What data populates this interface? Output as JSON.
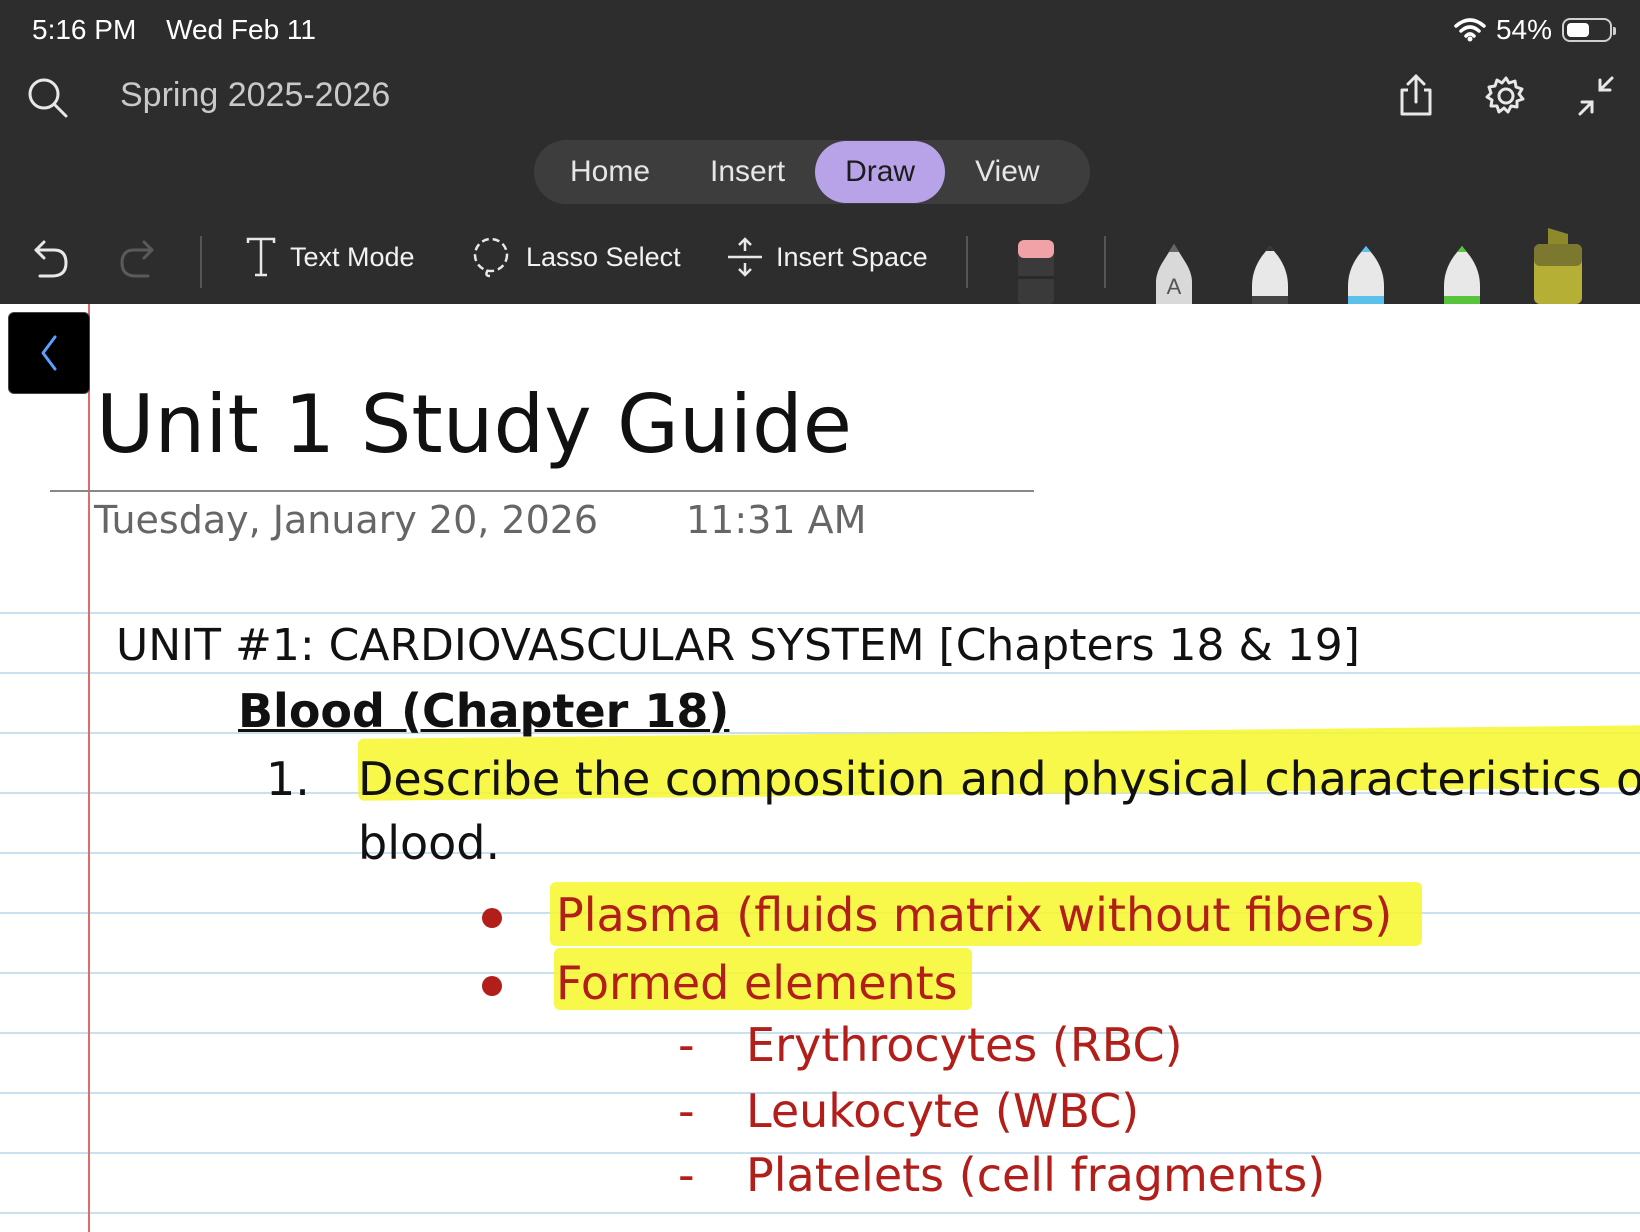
{
  "status_bar": {
    "time": "5:16 PM",
    "date": "Wed Feb 11",
    "battery": "54%",
    "battery_level": 0.54
  },
  "header": {
    "notebook_title": "Spring 2025-2026",
    "icons": [
      "search-icon",
      "share-icon",
      "settings-gear-icon",
      "collapse-arrows-icon"
    ]
  },
  "tabs": [
    {
      "label": "Home",
      "active": false
    },
    {
      "label": "Insert",
      "active": false
    },
    {
      "label": "Draw",
      "active": true
    },
    {
      "label": "View",
      "active": false
    }
  ],
  "toolbar": {
    "text_mode": "Text Mode",
    "lasso_select": "Lasso Select",
    "insert_space": "Insert Space",
    "pens": [
      {
        "name": "pencil-A",
        "tip_color": "#d9d9d9",
        "label": "A"
      },
      {
        "name": "pen-white",
        "tip_color": "#e8e8e8"
      },
      {
        "name": "pen-blue",
        "tip_color": "#5bc0ea"
      },
      {
        "name": "pen-green",
        "tip_color": "#58c33c"
      },
      {
        "name": "highlighter-yellow",
        "tip_color": "#b5b035"
      }
    ]
  },
  "page": {
    "title": "Unit 1 Study Guide",
    "date": "Tuesday, January 20, 2026",
    "time": "11:31 AM",
    "unit_heading": "UNIT #1: CARDIOVASCULAR SYSTEM [Chapters 18 & 19]",
    "section_heading": "Blood (Chapter 18)",
    "item_number": "1.",
    "item_text_line1": "Describe the composition and physical characteristics of w",
    "item_text_line2": "blood.",
    "bullets": [
      "Plasma (fluids matrix without fibers)",
      "Formed elements"
    ],
    "sub_dash": "-",
    "sub_items": [
      "Erythrocytes (RBC)",
      "Leukocyte (WBC)",
      "Platelets (cell fragments)"
    ],
    "highlight_color": "#f7f72a",
    "answer_color": "#b21e1a"
  }
}
